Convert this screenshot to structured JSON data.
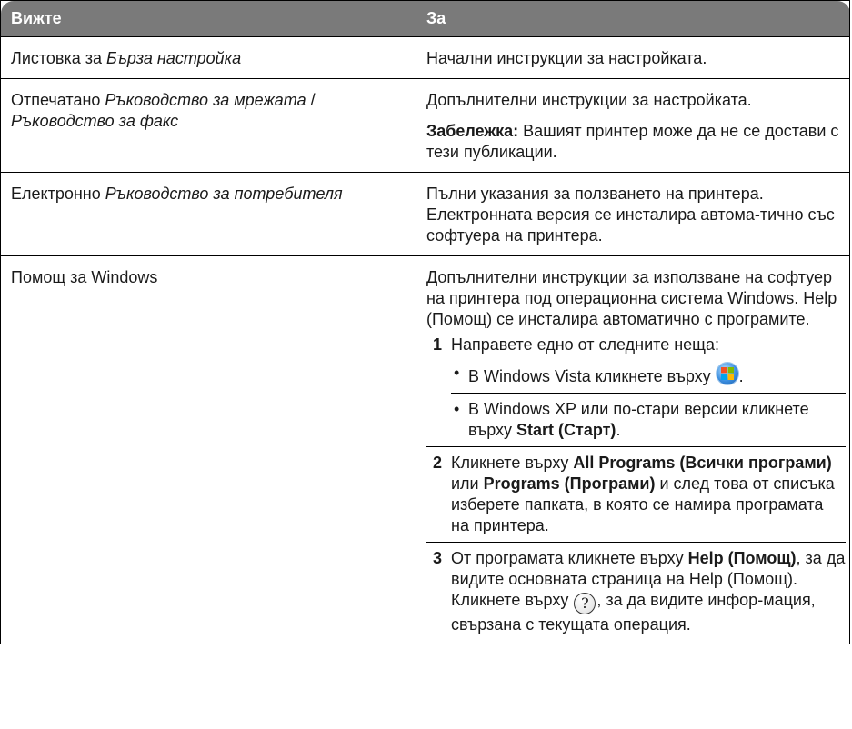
{
  "table": {
    "header": {
      "col1": "Вижте",
      "col2": "За"
    },
    "rows": [
      {
        "left_prefix": "Листовка за ",
        "left_italic": "Бърза настройка",
        "right_text": "Начални инструкции за настройката."
      },
      {
        "left_prefix": "Отпечатано ",
        "left_italic": "Ръководство за мрежата",
        "left_sep": " / ",
        "left_italic2": "Ръководство за факс",
        "right_text": "Допълнителни инструкции за настройката.",
        "note_label": "Забележка:",
        "note_text": " Вашият принтер може да не се достави с тези публикации."
      },
      {
        "left_prefix": "Електронно ",
        "left_italic": "Ръководство за потребителя",
        "right_text": "Пълни указания за ползването на принтера. Електронната версия се инсталира автома-тично със софтуера на принтера."
      },
      {
        "left_text": "Помощ за Windows",
        "right_intro": "Допълнителни инструкции за използване на софтуер на принтера под операционна система Windows. Help (Помощ) се инсталира автоматично с програмите.",
        "steps": [
          {
            "num": "1",
            "text": "Направете едно от следните неща:",
            "bullets": [
              {
                "dot": "•",
                "pre": "В Windows Vista кликнете върху ",
                "icon": "windows-vista-start-icon",
                "post": "."
              },
              {
                "dot": "•",
                "pre": "В Windows XP или по-стари версии кликнете върху ",
                "bold": "Start (Старт)",
                "post": "."
              }
            ]
          },
          {
            "num": "2",
            "pre": "Кликнете върху ",
            "bold1": "All Programs (Всички програми)",
            "mid": " или ",
            "bold2": "Programs (Програми)",
            "post": " и след това от списъка изберете папката, в която се намира програмата на принтера."
          },
          {
            "num": "3",
            "pre": "От програмата кликнете върху ",
            "bold": "Help (Помощ)",
            "post": ", за да видите основната страница на Help (Помощ).",
            "after_pre": "Кликнете върху ",
            "after_icon": "help-question-icon",
            "after_icon_glyph": "?",
            "after_post": ", за да видите инфор-мация, свързана с текущата операция."
          }
        ]
      }
    ]
  }
}
